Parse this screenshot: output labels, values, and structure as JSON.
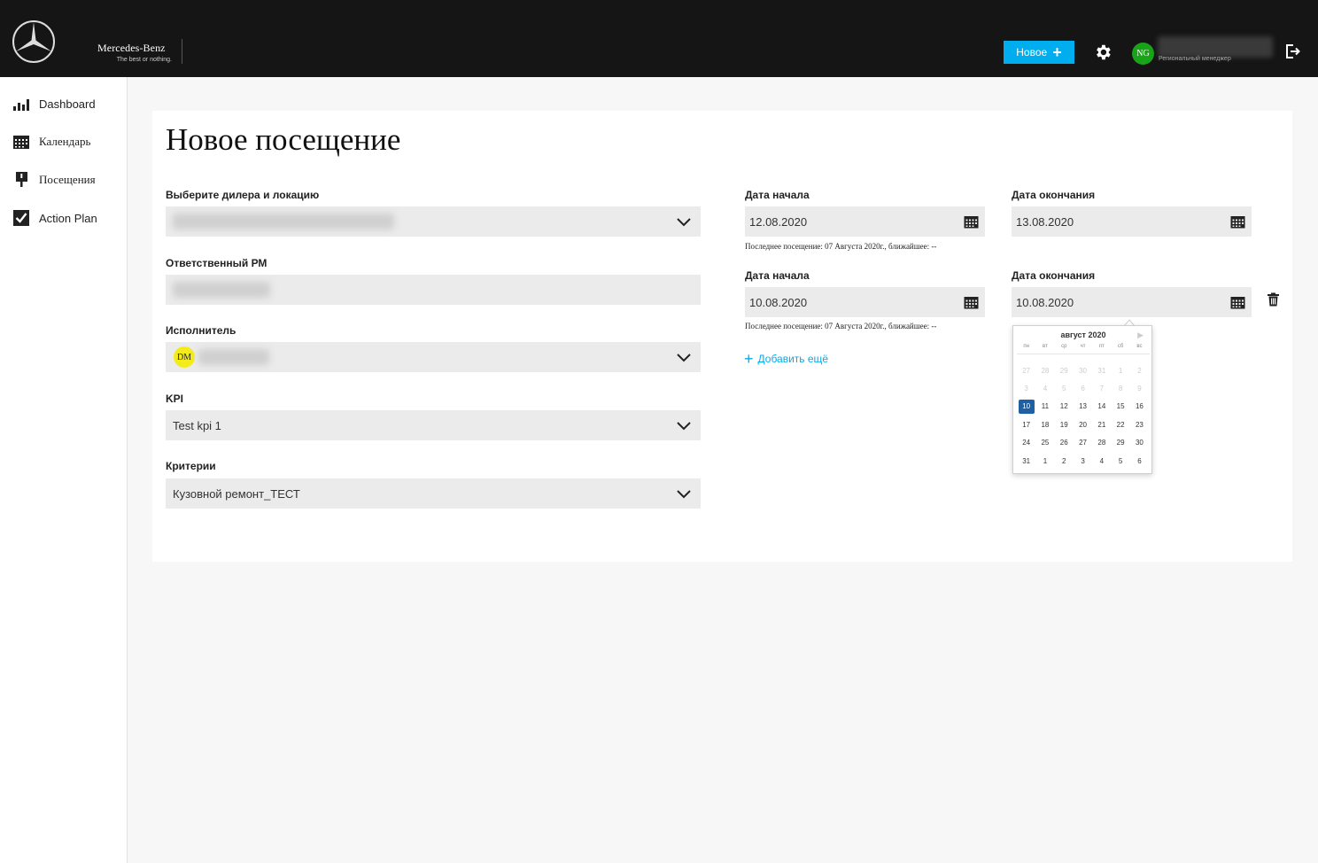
{
  "header": {
    "brand_name": "Mercedes-Benz",
    "brand_tagline": "The best or nothing.",
    "new_button_label": "Новое",
    "avatar_initials": "NG",
    "user_role": "Региональный менеджер"
  },
  "sidebar": {
    "items": [
      {
        "label": "Dashboard",
        "icon": "bar-chart-icon"
      },
      {
        "label": "Календарь",
        "icon": "calendar-icon"
      },
      {
        "label": "Посещения",
        "icon": "pin-icon"
      },
      {
        "label": "Action Plan",
        "icon": "checkbox-icon"
      }
    ]
  },
  "form": {
    "title": "Новое посещение",
    "dealer_label": "Выберите дилера и локацию",
    "rm_label": "Ответственный РМ",
    "executor_label": "Исполнитель",
    "executor_initials": "DM",
    "kpi_label": "KPI",
    "kpi_value": "Test kpi 1",
    "criteria_label": "Критерии",
    "criteria_value": "Кузовной ремонт_ТЕСТ"
  },
  "dates": {
    "rows": [
      {
        "start_label": "Дата начала",
        "start_value": "12.08.2020",
        "end_label": "Дата окончания",
        "end_value": "13.08.2020",
        "hint": "Последнее посещение: 07 Августа 2020г., ближайшее: --"
      },
      {
        "start_label": "Дата начала",
        "start_value": "10.08.2020",
        "end_label": "Дата окончания",
        "end_value": "10.08.2020",
        "hint": "Последнее посещение: 07 Августа 2020г., ближайшее: --"
      }
    ],
    "add_more_label": "Добавить ещё"
  },
  "datepicker": {
    "month_label": "август 2020",
    "weekdays": [
      "пн",
      "вт",
      "ср",
      "чт",
      "пт",
      "сб",
      "вс"
    ],
    "selected": "10",
    "days": [
      [
        "27",
        "28",
        "29",
        "30",
        "31",
        "1",
        "2"
      ],
      [
        "3",
        "4",
        "5",
        "6",
        "7",
        "8",
        "9"
      ],
      [
        "10",
        "11",
        "12",
        "13",
        "14",
        "15",
        "16"
      ],
      [
        "17",
        "18",
        "19",
        "20",
        "21",
        "22",
        "23"
      ],
      [
        "24",
        "25",
        "26",
        "27",
        "28",
        "29",
        "30"
      ],
      [
        "31",
        "1",
        "2",
        "3",
        "4",
        "5",
        "6"
      ]
    ],
    "dim_days": [
      [
        true,
        true,
        true,
        true,
        true,
        true,
        true
      ],
      [
        true,
        true,
        true,
        true,
        true,
        true,
        true
      ],
      [
        false,
        false,
        false,
        false,
        false,
        false,
        false
      ],
      [
        false,
        false,
        false,
        false,
        false,
        false,
        false
      ],
      [
        false,
        false,
        false,
        false,
        false,
        false,
        false
      ],
      [
        false,
        false,
        false,
        false,
        false,
        false,
        false
      ]
    ]
  },
  "colors": {
    "accent": "#00adef",
    "selected_day": "#1f5fa4",
    "avatar_green": "#19a319",
    "executor_badge": "#f4ec1a"
  }
}
